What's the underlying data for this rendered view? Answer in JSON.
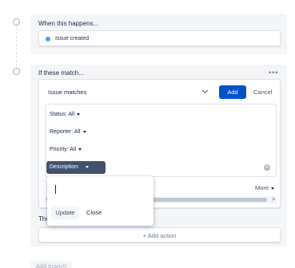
{
  "trigger": {
    "title": "When this happens...",
    "item": "Issue created"
  },
  "condition": {
    "title": "If these match...",
    "menu_icon": "more-dots-icon",
    "select": {
      "value": "Issue matches"
    },
    "add_label": "Add",
    "cancel_label": "Cancel",
    "filters": [
      {
        "label": "Status: All"
      },
      {
        "label": "Reporter: All"
      },
      {
        "label": "Priority: All"
      }
    ],
    "active_filter": {
      "label": "Description:"
    },
    "more_label": "More",
    "popover": {
      "input_value": "",
      "update_label": "Update",
      "close_label": "Close"
    }
  },
  "then": {
    "title_visible": "The",
    "add_action_label": "+ Add action"
  },
  "add_branch_label": "Add branch",
  "colors": {
    "primary": "#0052cc",
    "chip": "#42526e",
    "card_bg": "#f4f5f7",
    "dot": "#4c9aff"
  }
}
